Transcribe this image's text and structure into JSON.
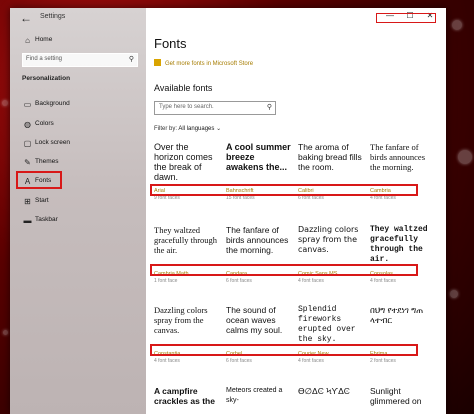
{
  "window": {
    "title": "Settings"
  },
  "sidebar": {
    "home_label": "Home",
    "search_placeholder": "Find a setting",
    "section": "Personalization",
    "items": [
      {
        "label": "Background",
        "icon": "image-icon"
      },
      {
        "label": "Colors",
        "icon": "palette-icon"
      },
      {
        "label": "Lock screen",
        "icon": "lock-screen-icon"
      },
      {
        "label": "Themes",
        "icon": "brush-icon"
      },
      {
        "label": "Fonts",
        "icon": "font-icon"
      },
      {
        "label": "Start",
        "icon": "start-icon"
      },
      {
        "label": "Taskbar",
        "icon": "taskbar-icon"
      }
    ]
  },
  "controls": {
    "minimize": "—",
    "maximize": "☐",
    "close": "✕"
  },
  "main": {
    "title": "Fonts",
    "store_link": "Get more fonts in Microsoft Store",
    "available_title": "Available fonts",
    "search_placeholder": "Type here to search.",
    "filter_label": "Filter by:",
    "filter_value": "All languages",
    "fonts": [
      {
        "sample": "Over the horizon comes the break of dawn.",
        "name": "Arial",
        "faces": "9 font faces"
      },
      {
        "sample": "A cool summer breeze awakens the...",
        "name": "Bahnschrift",
        "faces": "15 font faces"
      },
      {
        "sample": "The aroma of baking bread fills the room.",
        "name": "Calibri",
        "faces": "6 font faces"
      },
      {
        "sample": "The fanfare of birds announces the morning.",
        "name": "Cambria",
        "faces": "4 font faces"
      },
      {
        "sample": "They waltzed gracefully through the air.",
        "name": "Cambria Math",
        "faces": "1 font face"
      },
      {
        "sample": "The fanfare of birds announces the morning.",
        "name": "Candara",
        "faces": "6 font faces"
      },
      {
        "sample": "Dazzling colors spray from the canvas.",
        "name": "Comic Sans MS",
        "faces": "4 font faces"
      },
      {
        "sample": "They waltzed gracefully through the air.",
        "name": "Consolas",
        "faces": "4 font faces"
      },
      {
        "sample": "Dazzling colors spray from the canvas.",
        "name": "Constantia",
        "faces": "4 font faces"
      },
      {
        "sample": "The sound of ocean waves calms my soul.",
        "name": "Corbel",
        "faces": "6 font faces"
      },
      {
        "sample": "Splendid fireworks erupted over the sky.",
        "name": "Courier New",
        "faces": "4 font faces"
      },
      {
        "sample": "በህግ የተደነገ ግጠ ላተብር",
        "name": "Ebrima",
        "faces": "2 font faces"
      },
      {
        "sample": "A campfire crackles as the",
        "name": "",
        "faces": ""
      },
      {
        "sample": "Meteors created a sky-",
        "name": "",
        "faces": ""
      },
      {
        "sample": "ϴ∅ΔϾ ϞϒΔϾ",
        "name": "",
        "faces": ""
      },
      {
        "sample": "Sunlight glimmered on",
        "name": "",
        "faces": ""
      }
    ]
  }
}
